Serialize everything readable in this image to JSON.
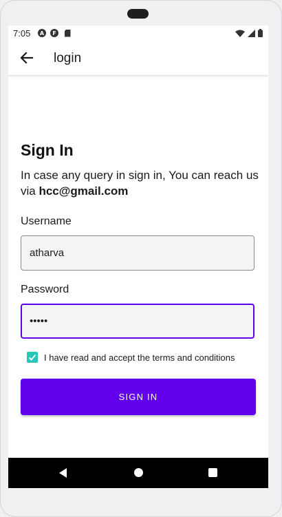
{
  "status_bar": {
    "time": "7:05",
    "left_icons": [
      "a-circle-icon",
      "f-circle-icon",
      "sd-card-icon"
    ],
    "left_icon_letters": [
      "A",
      "F"
    ],
    "right_icons": [
      "wifi-icon",
      "cell-signal-icon",
      "battery-icon"
    ]
  },
  "app_bar": {
    "title": "login",
    "back_icon": "arrow-back-icon"
  },
  "form": {
    "heading": "Sign In",
    "info_text": "In case any query in sign in, You can reach us via ",
    "info_email": "hcc@gmail.com",
    "username_label": "Username",
    "username_value": "atharva",
    "password_label": "Password",
    "password_value": "•••••",
    "terms_checked": true,
    "terms_label": "I have read and accept the terms and conditions",
    "submit_label": "SIGN IN"
  },
  "colors": {
    "accent": "#6200ee",
    "checkbox": "#26c6b8",
    "navbar": "#000000"
  },
  "nav_bar": {
    "icons": [
      "nav-back-icon",
      "nav-home-icon",
      "nav-recents-icon"
    ]
  }
}
